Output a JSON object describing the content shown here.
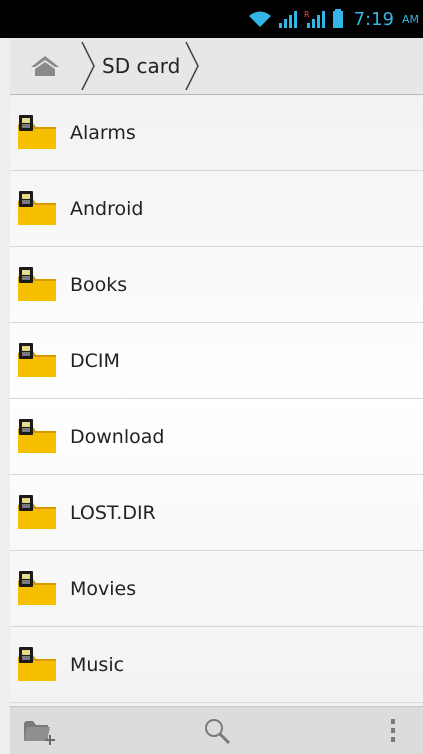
{
  "status_bar": {
    "time": "7:19",
    "ampm": "AM",
    "icons": [
      "wifi-icon",
      "signal-icon",
      "roaming-signal-icon",
      "battery-icon"
    ],
    "roaming_label": "R"
  },
  "breadcrumb": {
    "home_icon": "home-icon",
    "current": "SD card"
  },
  "folders": [
    {
      "label": "Alarms"
    },
    {
      "label": "Android"
    },
    {
      "label": "Books"
    },
    {
      "label": "DCIM"
    },
    {
      "label": "Download"
    },
    {
      "label": "LOST.DIR"
    },
    {
      "label": "Movies"
    },
    {
      "label": "Music"
    }
  ],
  "bottom_bar": {
    "buttons": [
      "new-folder-icon",
      "search-icon",
      "overflow-menu-icon"
    ]
  },
  "colors": {
    "accent": "#33b5e5",
    "folder": "#f6c000",
    "statusbar": "#000000"
  }
}
